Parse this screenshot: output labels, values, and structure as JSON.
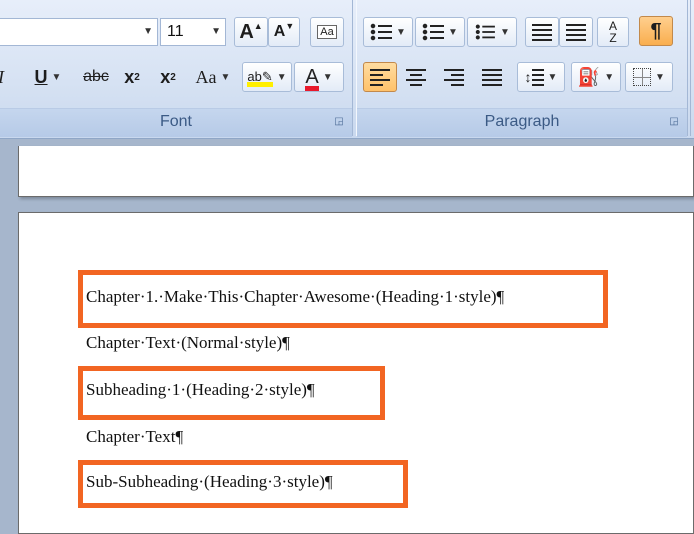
{
  "ribbon": {
    "font_group": {
      "label": "Font",
      "font_size": "11",
      "grow_font_label": "A",
      "shrink_font_label": "A",
      "underline_label": "U",
      "strike_label": "abc",
      "subscript_label": "x",
      "subscript_mark": "2",
      "superscript_label": "x",
      "superscript_mark": "2",
      "change_case_label": "Aa",
      "highlight_label": "ab",
      "font_color_label": "A",
      "clear_format_label": "Aa"
    },
    "paragraph_group": {
      "label": "Paragraph",
      "show_marks_label": "¶",
      "sort_label_top": "A",
      "sort_label_bottom": "Z"
    }
  },
  "document": {
    "paragraphs": [
      {
        "text": "Chapter·1.·Make·This·Chapter·Awesome·(Heading·1·style)¶",
        "highlighted": true
      },
      {
        "text": "Chapter·Text·(Normal·style)¶",
        "highlighted": false
      },
      {
        "text": "Subheading·1·(Heading·2·style)¶",
        "highlighted": true
      },
      {
        "text": "Chapter·Text¶",
        "highlighted": false
      },
      {
        "text": "Sub-Subheading·(Heading·3·style)¶",
        "highlighted": true
      }
    ]
  },
  "colors": {
    "highlight_outline": "#f26522",
    "active_button": "#ffc26a",
    "highlight_swatch": "#ffef00",
    "font_color_swatch": "#e8192c"
  }
}
